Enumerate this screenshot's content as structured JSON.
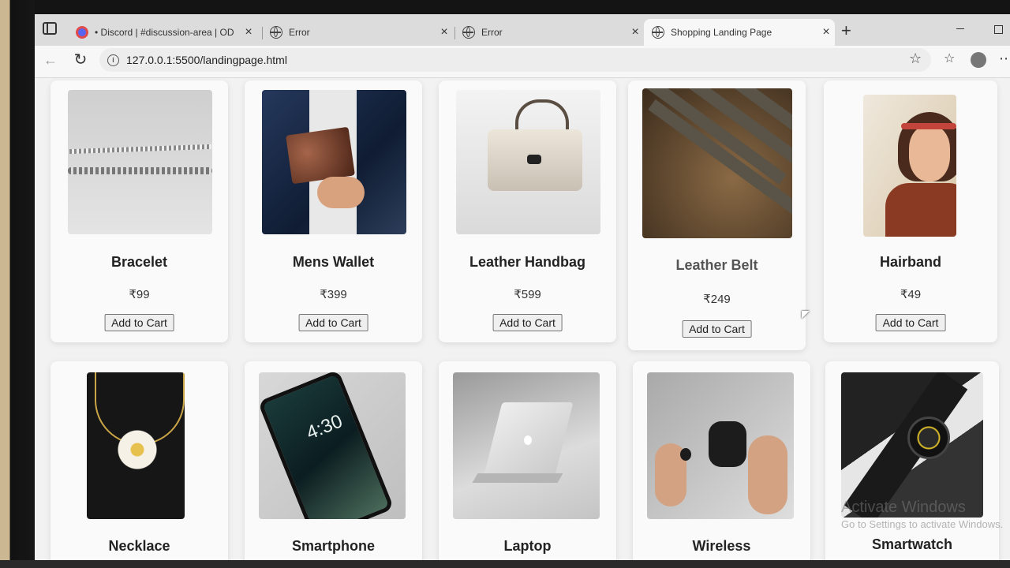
{
  "browser": {
    "tabs": [
      {
        "title": "• Discord | #discussion-area | OD",
        "favicon": "discord-icon",
        "active": false
      },
      {
        "title": "Error",
        "favicon": "globe-icon",
        "active": false
      },
      {
        "title": "Error",
        "favicon": "globe-icon",
        "active": false
      },
      {
        "title": "Shopping Landing Page",
        "favicon": "globe-icon",
        "active": true
      }
    ],
    "new_tab": "+",
    "url": "127.0.0.1:5500/landingpage.html"
  },
  "products": [
    {
      "name": "Bracelet",
      "price": "₹99",
      "button": "Add to Cart"
    },
    {
      "name": "Mens Wallet",
      "price": "₹399",
      "button": "Add to Cart"
    },
    {
      "name": "Leather Handbag",
      "price": "₹599",
      "button": "Add to Cart"
    },
    {
      "name": "Leather Belt",
      "price": "₹249",
      "button": "Add to Cart"
    },
    {
      "name": "Hairband",
      "price": "₹49",
      "button": "Add to Cart"
    },
    {
      "name": "Necklace"
    },
    {
      "name": "Smartphone"
    },
    {
      "name": "Laptop"
    },
    {
      "name": "Wireless"
    },
    {
      "name": "Smartwatch"
    }
  ],
  "watermark": {
    "line1": "Activate Windows",
    "line2": "Go to Settings to activate Windows."
  },
  "colors": {
    "page_bg": "#f2f2f2",
    "card_bg": "#fafafa",
    "button_bg": "#efefef"
  }
}
